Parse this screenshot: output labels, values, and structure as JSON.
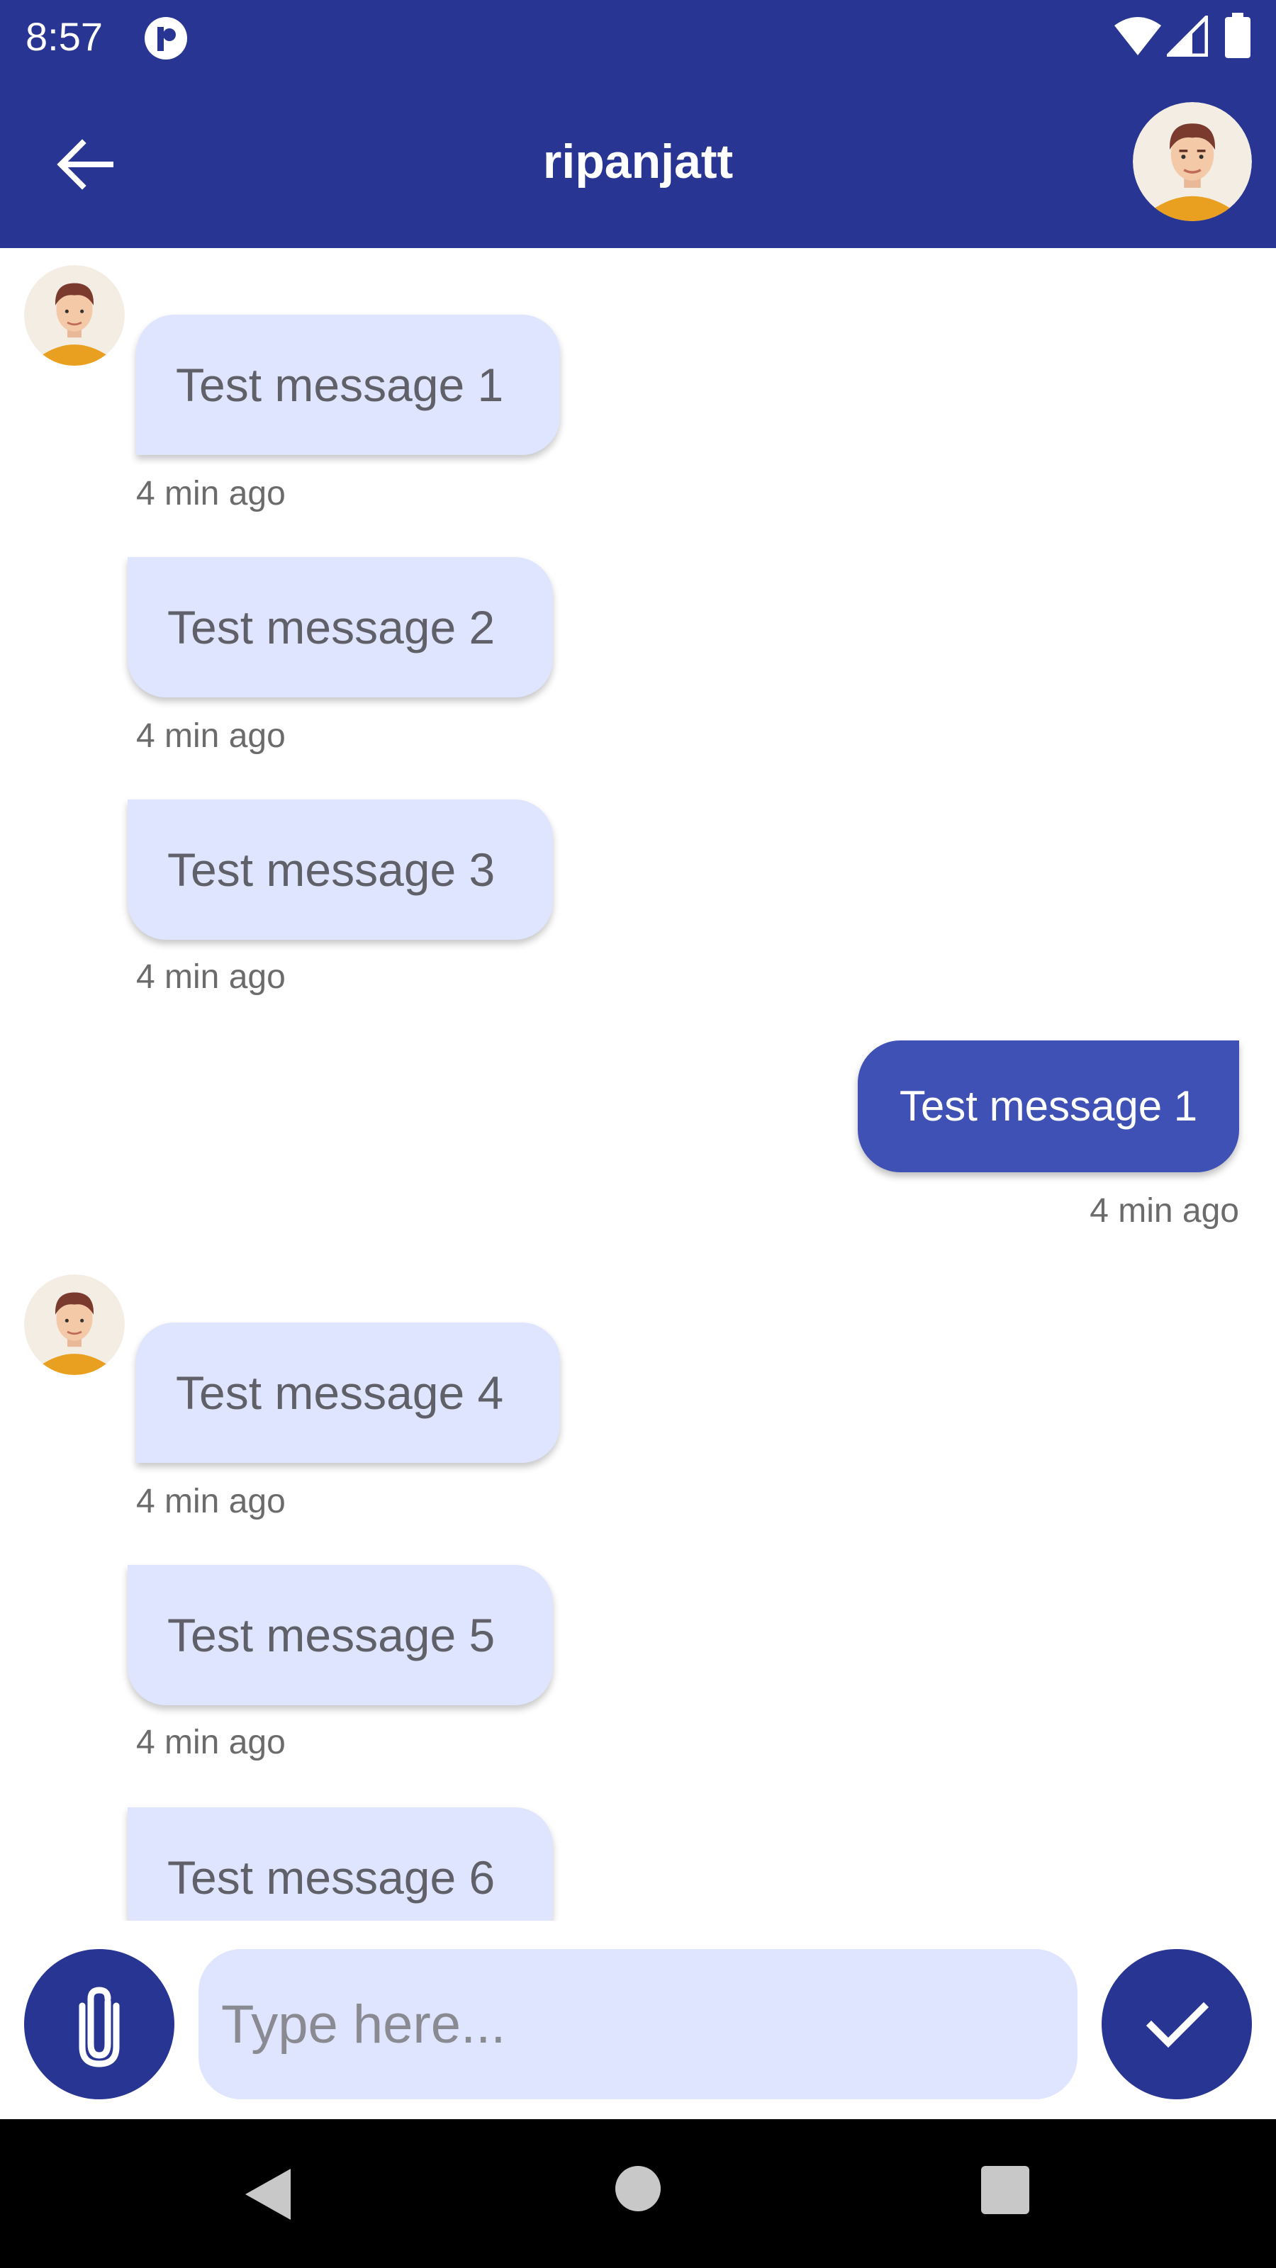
{
  "status_bar": {
    "time": "8:57"
  },
  "header": {
    "title": "ripanjatt"
  },
  "messages": [
    {
      "text": "Test message 1",
      "time": "4 min ago",
      "side": "in"
    },
    {
      "text": "Test message 2",
      "time": "4 min ago",
      "side": "in"
    },
    {
      "text": "Test message 3",
      "time": "4 min ago",
      "side": "in"
    },
    {
      "text": "Test message 1",
      "time": "4 min ago",
      "side": "out"
    },
    {
      "text": "Test message 4",
      "time": "4 min ago",
      "side": "in"
    },
    {
      "text": "Test message 5",
      "time": "4 min ago",
      "side": "in"
    },
    {
      "text": "Test message 6",
      "side": "in"
    }
  ],
  "composer": {
    "placeholder": "Type here..."
  },
  "colors": {
    "primary": "#283593",
    "outgoing_bubble": "#3f51b5",
    "incoming_bubble": "#e0e5ff"
  },
  "icons": [
    "back-arrow-icon",
    "attach-icon",
    "check-icon",
    "wifi-icon",
    "signal-icon",
    "battery-icon"
  ]
}
